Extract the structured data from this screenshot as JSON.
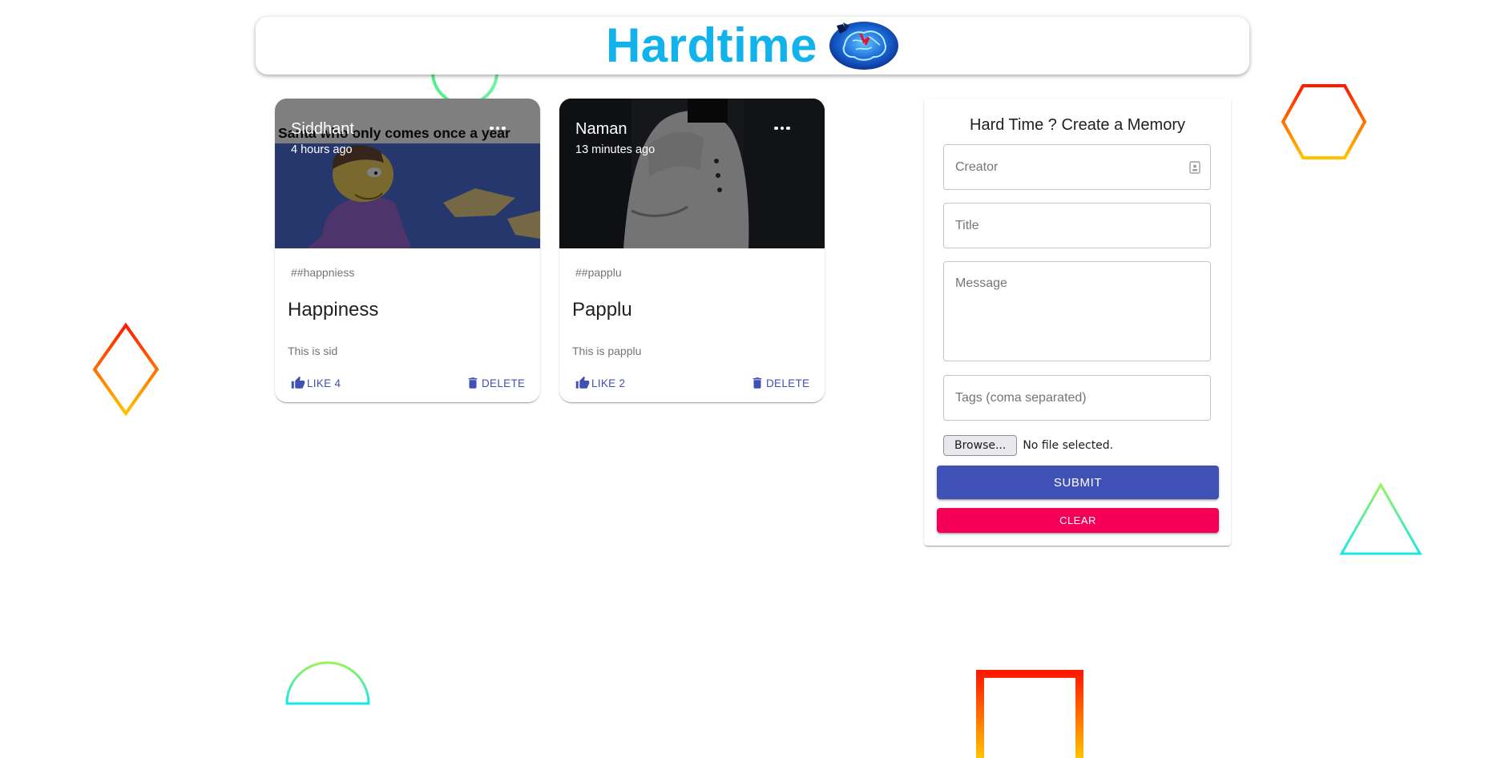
{
  "app": {
    "title": "Hardtime",
    "logo_icon": "brain-icon",
    "title_color": "#12b3ec"
  },
  "posts": [
    {
      "creator": "Siddhant",
      "time": "4 hours ago",
      "media_caption": "Santa who only comes once a year",
      "tags": "##happniess",
      "title": "Happiness",
      "message": "This is sid",
      "like_label": "LIKE 4",
      "delete_label": "DELETE",
      "more_icon": "more-horiz-icon"
    },
    {
      "creator": "Naman",
      "time": "13 minutes ago",
      "tags": "##papplu",
      "title": "Papplu",
      "message": "This is papplu",
      "like_label": "LIKE 2",
      "delete_label": "DELETE",
      "more_icon": "more-horiz-icon"
    }
  ],
  "form": {
    "heading": "Hard Time ? Create a Memory",
    "creator_placeholder": "Creator",
    "creator_value": "",
    "title_placeholder": "Title",
    "title_value": "",
    "message_placeholder": "Message",
    "message_value": "",
    "tags_placeholder": "Tags (coma separated)",
    "tags_value": "",
    "browse_label": "Browse...",
    "file_status": "No file selected.",
    "submit_label": "SUBMIT",
    "clear_label": "CLEAR"
  },
  "colors": {
    "primary": "#3f51b5",
    "secondary": "#f50057"
  }
}
